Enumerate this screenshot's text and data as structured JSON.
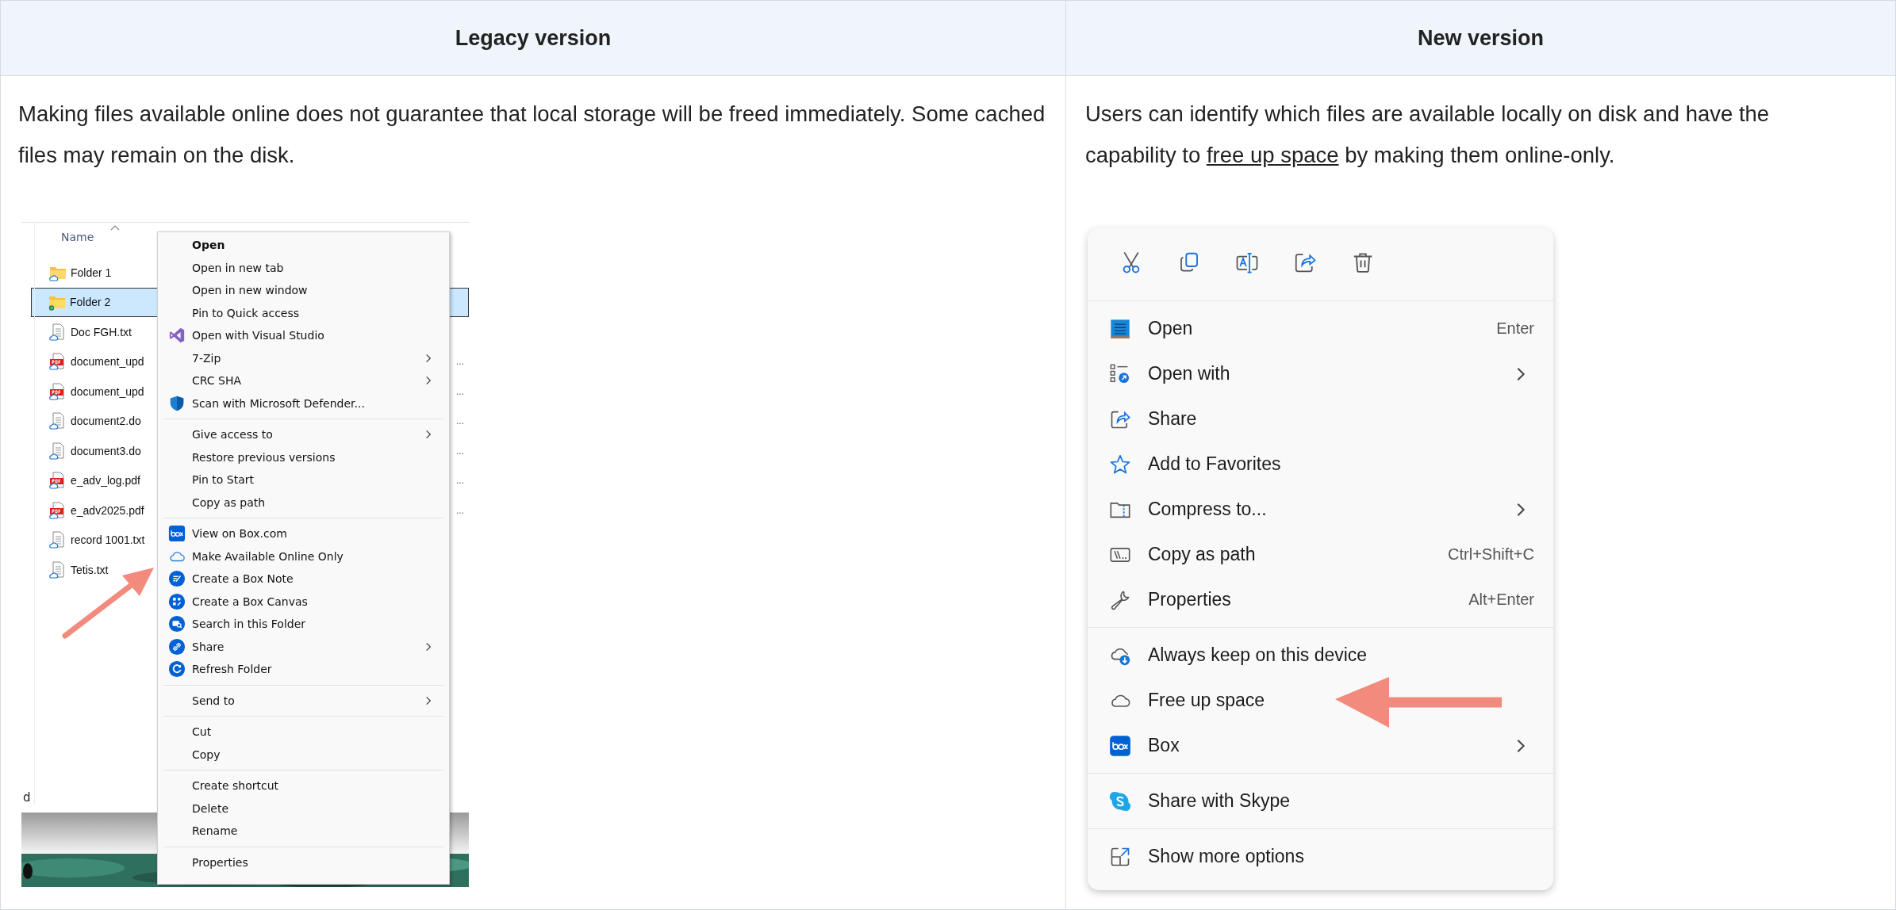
{
  "columns": [
    {
      "title": "Legacy version"
    },
    {
      "title": "New version"
    }
  ],
  "legacy": {
    "description": "Making files available online does not guarantee that local storage will be freed immediately. Some cached files may remain on the disk.",
    "explorer": {
      "header": "Name",
      "status_fragment": "d",
      "files": [
        {
          "name": "Folder 1",
          "kind": "folder",
          "synced": false,
          "selected": false
        },
        {
          "name": "Folder 2",
          "kind": "folder",
          "synced": true,
          "selected": true
        },
        {
          "name": "Doc FGH.txt",
          "kind": "text",
          "synced": false,
          "selected": false
        },
        {
          "name": "document_upd",
          "kind": "pdf",
          "synced": false,
          "selected": false,
          "detail": "..."
        },
        {
          "name": "document_upd",
          "kind": "pdf",
          "synced": false,
          "selected": false,
          "detail": "..."
        },
        {
          "name": "document2.do",
          "kind": "text",
          "synced": false,
          "selected": false,
          "detail": "..."
        },
        {
          "name": "document3.do",
          "kind": "text",
          "synced": false,
          "selected": false,
          "detail": "..."
        },
        {
          "name": "e_adv_log.pdf",
          "kind": "pdf",
          "synced": false,
          "selected": false,
          "detail": "..."
        },
        {
          "name": "e_adv2025.pdf",
          "kind": "pdf",
          "synced": false,
          "selected": false,
          "detail": "..."
        },
        {
          "name": "record 1001.txt",
          "kind": "text",
          "synced": false,
          "selected": false
        },
        {
          "name": "Tetis.txt",
          "kind": "text",
          "synced": false,
          "selected": false
        }
      ]
    },
    "menu": [
      [
        {
          "label": "Open",
          "default": true,
          "submenu": false
        },
        {
          "label": "Open in new tab",
          "default": false,
          "submenu": false
        },
        {
          "label": "Open in new window",
          "default": false,
          "submenu": false
        },
        {
          "label": "Pin to Quick access",
          "default": false,
          "submenu": false
        },
        {
          "label": "Open with Visual Studio",
          "kind": "vs",
          "default": false,
          "submenu": false
        },
        {
          "label": "7-Zip",
          "default": false,
          "submenu": true
        },
        {
          "label": "CRC SHA",
          "default": false,
          "submenu": true
        },
        {
          "label": "Scan with Microsoft Defender...",
          "kind": "shield",
          "default": false,
          "submenu": false
        }
      ],
      [
        {
          "label": "Give access to",
          "default": false,
          "submenu": true
        },
        {
          "label": "Restore previous versions",
          "default": false,
          "submenu": false
        },
        {
          "label": "Pin to Start",
          "default": false,
          "submenu": false
        },
        {
          "label": "Copy as path",
          "default": false,
          "submenu": false
        }
      ],
      [
        {
          "label": "View on Box.com",
          "kind": "box",
          "default": false,
          "submenu": false
        },
        {
          "label": "Make Available Online Only",
          "kind": "cloud",
          "default": false,
          "submenu": false
        },
        {
          "label": "Create a Box Note",
          "kind": "note",
          "default": false,
          "submenu": false
        },
        {
          "label": "Create a Box Canvas",
          "kind": "canvas",
          "default": false,
          "submenu": false
        },
        {
          "label": "Search in this Folder",
          "kind": "search",
          "default": false,
          "submenu": false
        },
        {
          "label": "Share",
          "kind": "link",
          "default": false,
          "submenu": true
        },
        {
          "label": "Refresh Folder",
          "kind": "refresh",
          "default": false,
          "submenu": false
        }
      ],
      [
        {
          "label": "Send to",
          "default": false,
          "submenu": true
        }
      ],
      [
        {
          "label": "Cut",
          "default": false,
          "submenu": false
        },
        {
          "label": "Copy",
          "default": false,
          "submenu": false
        }
      ],
      [
        {
          "label": "Create shortcut",
          "default": false,
          "submenu": false
        },
        {
          "label": "Delete",
          "default": false,
          "submenu": false
        },
        {
          "label": "Rename",
          "default": false,
          "submenu": false
        }
      ],
      [
        {
          "label": "Properties",
          "default": false,
          "submenu": false
        }
      ]
    ]
  },
  "new": {
    "description": [
      {
        "text": "Users can identify which files are available locally on disk and have the capability to "
      },
      {
        "text": "free up space",
        "kind": "link"
      },
      {
        "text": " by making them online-only."
      }
    ],
    "toolbar": [
      {
        "kind": "cut"
      },
      {
        "kind": "copy"
      },
      {
        "kind": "rename"
      },
      {
        "kind": "share"
      },
      {
        "kind": "delete"
      }
    ],
    "menu": [
      [
        {
          "label": "Open",
          "kind": "notepad",
          "shortcut": "Enter",
          "submenu": false
        },
        {
          "label": "Open with",
          "kind": "openwith",
          "submenu": true
        },
        {
          "label": "Share",
          "kind": "share",
          "submenu": false
        },
        {
          "label": "Add to Favorites",
          "kind": "star",
          "submenu": false
        },
        {
          "label": "Compress to...",
          "kind": "zip",
          "submenu": true
        },
        {
          "label": "Copy as path",
          "kind": "path",
          "shortcut": "Ctrl+Shift+C",
          "submenu": false
        },
        {
          "label": "Properties",
          "kind": "wrench",
          "shortcut": "Alt+Enter",
          "submenu": false
        }
      ],
      [
        {
          "label": "Always keep on this device",
          "kind": "clouddown",
          "submenu": false
        },
        {
          "label": "Free up space",
          "kind": "cloud",
          "submenu": false
        },
        {
          "label": "Box",
          "kind": "box",
          "submenu": true
        }
      ],
      [
        {
          "label": "Share with Skype",
          "kind": "skype",
          "submenu": false
        }
      ],
      [
        {
          "label": "Show more options",
          "kind": "more",
          "submenu": false
        }
      ]
    ]
  }
}
